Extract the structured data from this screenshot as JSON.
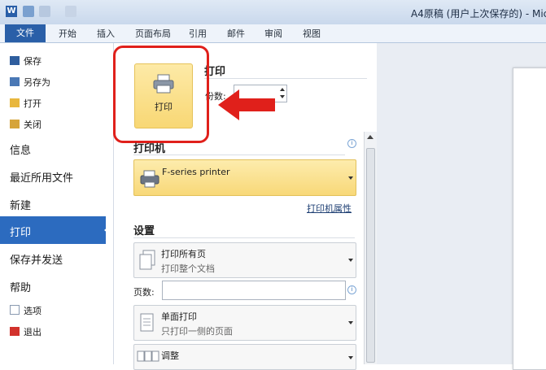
{
  "window": {
    "title": "A4原稿 (用户上次保存的) - Micros"
  },
  "ribbon": {
    "tabs": [
      "文件",
      "开始",
      "插入",
      "页面布局",
      "引用",
      "邮件",
      "审阅",
      "视图"
    ]
  },
  "nav": {
    "save": "保存",
    "save_as": "另存为",
    "open": "打开",
    "close": "关闭",
    "info": "信息",
    "recent": "最近所用文件",
    "new": "新建",
    "print": "打印",
    "save_send": "保存并发送",
    "help": "帮助",
    "options": "选项",
    "exit": "退出"
  },
  "print_panel": {
    "heading": "打印",
    "print_button": "打印",
    "copies_label": "份数:",
    "copies_value": "",
    "printer_section": "打印机",
    "printer_name": "F-series printer",
    "printer_properties": "打印机属性",
    "settings_section": "设置",
    "print_range_title": "打印所有页",
    "print_range_desc": "打印整个文档",
    "pages_label": "页数:",
    "pages_value": "",
    "sides_title": "单面打印",
    "sides_desc": "只打印一侧的页面",
    "collate_title": "调整"
  },
  "colors": {
    "file_tab": "#2a5fa8",
    "selected_nav": "#2c6bbf",
    "highlight": "#e0201b",
    "print_button": "#f8d774"
  },
  "icons": [
    "save-icon",
    "save-as-icon",
    "open-folder-icon",
    "close-doc-icon",
    "printer-icon",
    "info-icon",
    "options-icon",
    "exit-icon",
    "pages-icon",
    "single-side-icon",
    "collate-icon",
    "red-arrow-icon"
  ]
}
